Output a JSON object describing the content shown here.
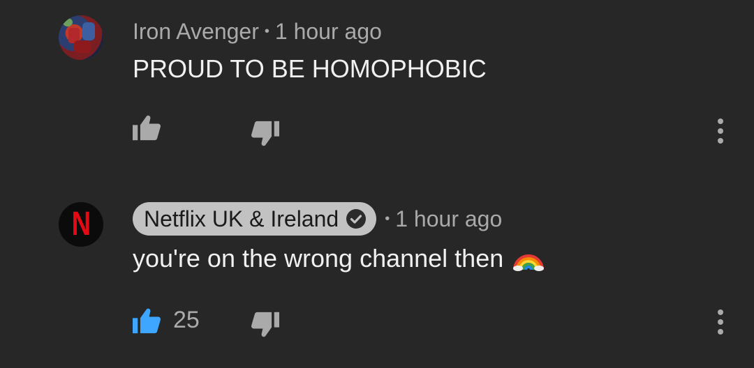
{
  "comments": [
    {
      "author": "Iron Avenger",
      "separator": "•",
      "time": "1 hour ago",
      "text": "PROUD TO BE HOMOPHOBIC",
      "like_count": "",
      "liked": false,
      "author_verified": false,
      "avatar_icon": "avengers-avatar"
    },
    {
      "author": "Netflix UK & Ireland",
      "separator": "•",
      "time": "1 hour ago",
      "text": "you're on the wrong channel then",
      "emoji": "rainbow",
      "like_count": "25",
      "liked": true,
      "author_verified": true,
      "avatar_icon": "netflix-logo",
      "avatar_letter": "N"
    }
  ],
  "colors": {
    "background": "#272727",
    "text_primary": "#f1f1f1",
    "text_secondary": "#aaaaaa",
    "like_active": "#3ea6ff",
    "netflix_red": "#e50914",
    "channel_chip": "#c2c2c2"
  }
}
